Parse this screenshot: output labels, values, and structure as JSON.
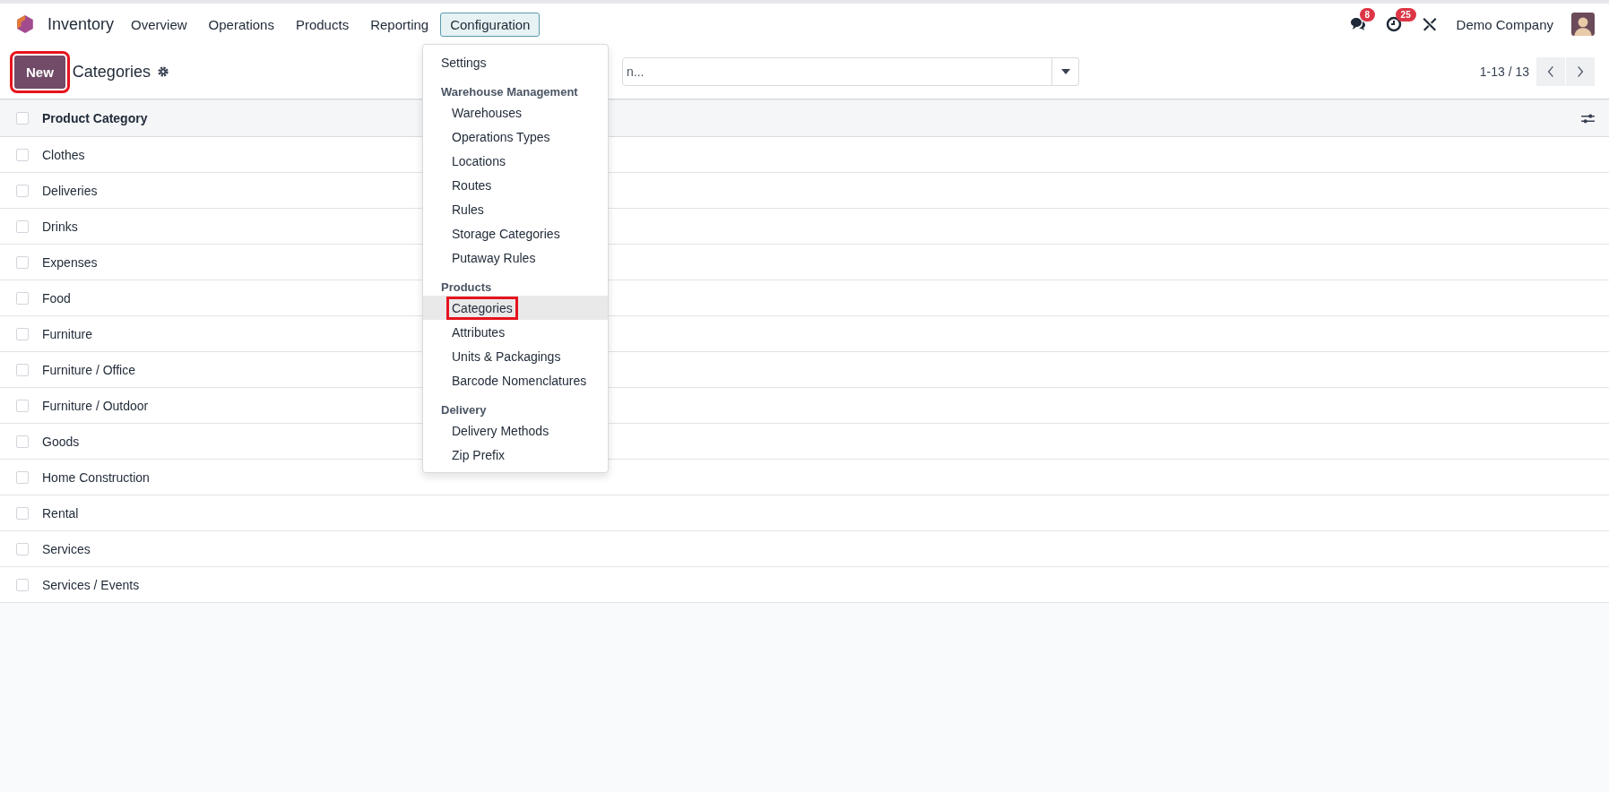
{
  "navbar": {
    "app_name": "Inventory",
    "menus": [
      {
        "label": "Overview",
        "selected": false
      },
      {
        "label": "Operations",
        "selected": false
      },
      {
        "label": "Products",
        "selected": false
      },
      {
        "label": "Reporting",
        "selected": false
      },
      {
        "label": "Configuration",
        "selected": true
      }
    ],
    "messages_badge": "8",
    "activities_badge": "25",
    "company": "Demo Company"
  },
  "control_panel": {
    "new_button": {
      "label": "New",
      "annotated": true
    },
    "title": "Categories",
    "search": {
      "placeholder": "n..."
    },
    "pager": "1-13 / 13"
  },
  "dropdown": [
    {
      "kind": "item",
      "label": "Settings",
      "selected": false,
      "annotated": false
    },
    {
      "kind": "header",
      "label": "Warehouse Management"
    },
    {
      "kind": "subitem",
      "label": "Warehouses",
      "selected": false,
      "annotated": false
    },
    {
      "kind": "subitem",
      "label": "Operations Types",
      "selected": false,
      "annotated": false
    },
    {
      "kind": "subitem",
      "label": "Locations",
      "selected": false,
      "annotated": false
    },
    {
      "kind": "subitem",
      "label": "Routes",
      "selected": false,
      "annotated": false
    },
    {
      "kind": "subitem",
      "label": "Rules",
      "selected": false,
      "annotated": false
    },
    {
      "kind": "subitem",
      "label": "Storage Categories",
      "selected": false,
      "annotated": false
    },
    {
      "kind": "subitem",
      "label": "Putaway Rules",
      "selected": false,
      "annotated": false
    },
    {
      "kind": "header",
      "label": "Products"
    },
    {
      "kind": "subitem",
      "label": "Categories",
      "selected": true,
      "annotated": true
    },
    {
      "kind": "subitem",
      "label": "Attributes",
      "selected": false,
      "annotated": false
    },
    {
      "kind": "subitem",
      "label": "Units & Packagings",
      "selected": false,
      "annotated": false
    },
    {
      "kind": "subitem",
      "label": "Barcode Nomenclatures",
      "selected": false,
      "annotated": false
    },
    {
      "kind": "header",
      "label": "Delivery"
    },
    {
      "kind": "subitem",
      "label": "Delivery Methods",
      "selected": false,
      "annotated": false
    },
    {
      "kind": "subitem",
      "label": "Zip Prefix",
      "selected": false,
      "annotated": false
    }
  ],
  "table": {
    "columns": [
      "Product Category"
    ],
    "header_checked": false,
    "rows": [
      {
        "name": "Clothes",
        "checked": false
      },
      {
        "name": "Deliveries",
        "checked": false
      },
      {
        "name": "Drinks",
        "checked": false
      },
      {
        "name": "Expenses",
        "checked": false
      },
      {
        "name": "Food",
        "checked": false
      },
      {
        "name": "Furniture",
        "checked": false
      },
      {
        "name": "Furniture / Office",
        "checked": false
      },
      {
        "name": "Furniture / Outdoor",
        "checked": false
      },
      {
        "name": "Goods",
        "checked": false
      },
      {
        "name": "Home Construction",
        "checked": false
      },
      {
        "name": "Rental",
        "checked": false
      },
      {
        "name": "Services",
        "checked": false
      },
      {
        "name": "Services / Events",
        "checked": false
      }
    ]
  }
}
